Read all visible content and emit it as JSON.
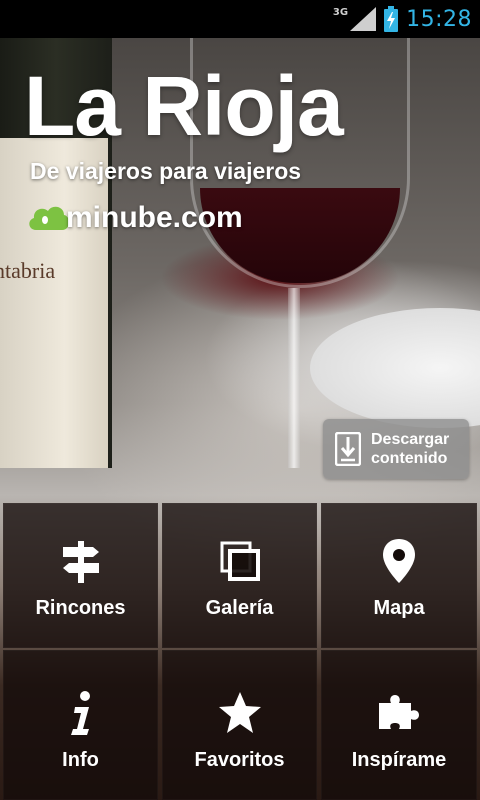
{
  "status_bar": {
    "network": "3G",
    "time": "15:28",
    "accent_color": "#33b5e5",
    "icons": [
      "signal-icon",
      "battery-charging-icon"
    ]
  },
  "hero": {
    "title": "La Rioja",
    "subtitle": "De viajeros para viajeros",
    "brand": "minube.com",
    "bottle_label_fragment": "ntabria",
    "download_button": {
      "label": "Descargar contenido",
      "icon": "download-icon"
    }
  },
  "menu": {
    "items": [
      {
        "label": "Rincones",
        "icon": "signpost-icon"
      },
      {
        "label": "Galería",
        "icon": "gallery-icon"
      },
      {
        "label": "Mapa",
        "icon": "map-pin-icon"
      },
      {
        "label": "Info",
        "icon": "info-icon"
      },
      {
        "label": "Favoritos",
        "icon": "star-icon"
      },
      {
        "label": "Inspírame",
        "icon": "puzzle-icon"
      }
    ]
  }
}
